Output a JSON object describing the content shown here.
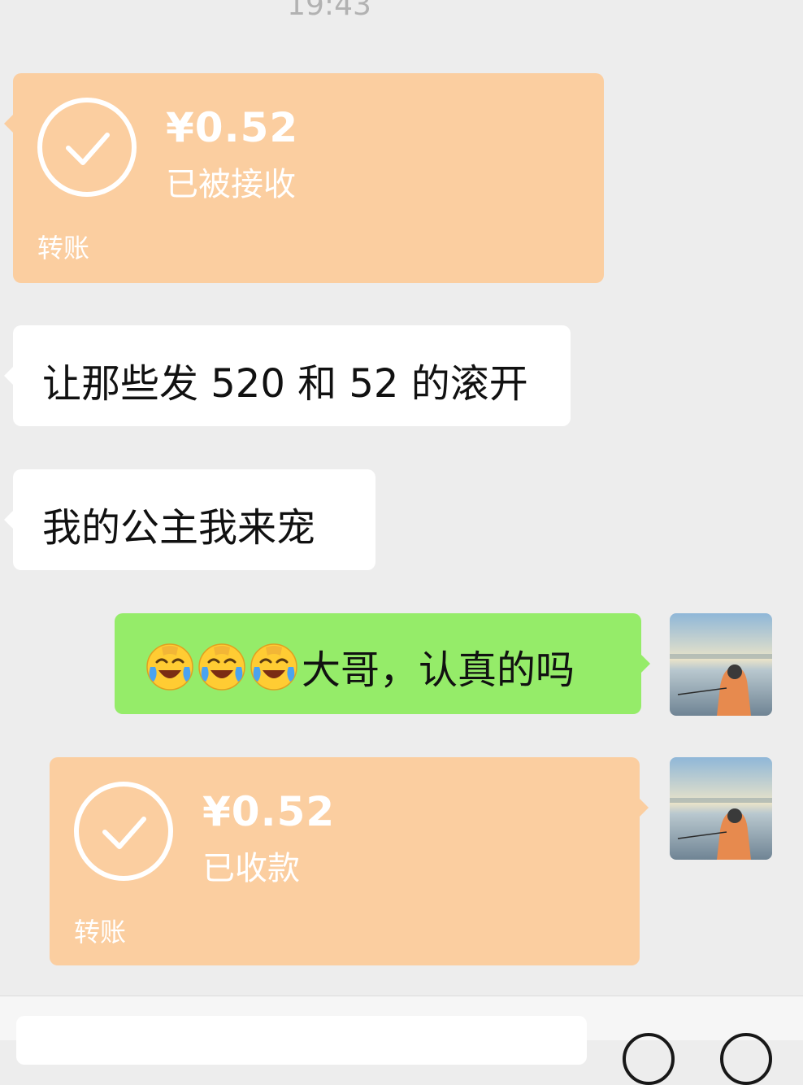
{
  "timestamp": "19:43",
  "messages": [
    {
      "side": "left",
      "kind": "transfer",
      "amount": "¥0.52",
      "status": "已被接收",
      "label": "转账"
    },
    {
      "side": "left",
      "kind": "text",
      "text": "让那些发 520 和 52 的滚开"
    },
    {
      "side": "left",
      "kind": "text",
      "text": "我的公主我来宠"
    },
    {
      "side": "right",
      "kind": "text",
      "emoji": [
        "face-with-tears-of-joy-icon",
        "face-with-tears-of-joy-icon",
        "face-with-tears-of-joy-icon"
      ],
      "text": "大哥，认真的吗"
    },
    {
      "side": "right",
      "kind": "transfer",
      "amount": "¥0.52",
      "status": "已收款",
      "label": "转账"
    }
  ],
  "colors": {
    "background": "#ededed",
    "transfer_bubble": "#fbcea0",
    "received_bubble": "#ffffff",
    "sent_bubble": "#95ec69"
  }
}
